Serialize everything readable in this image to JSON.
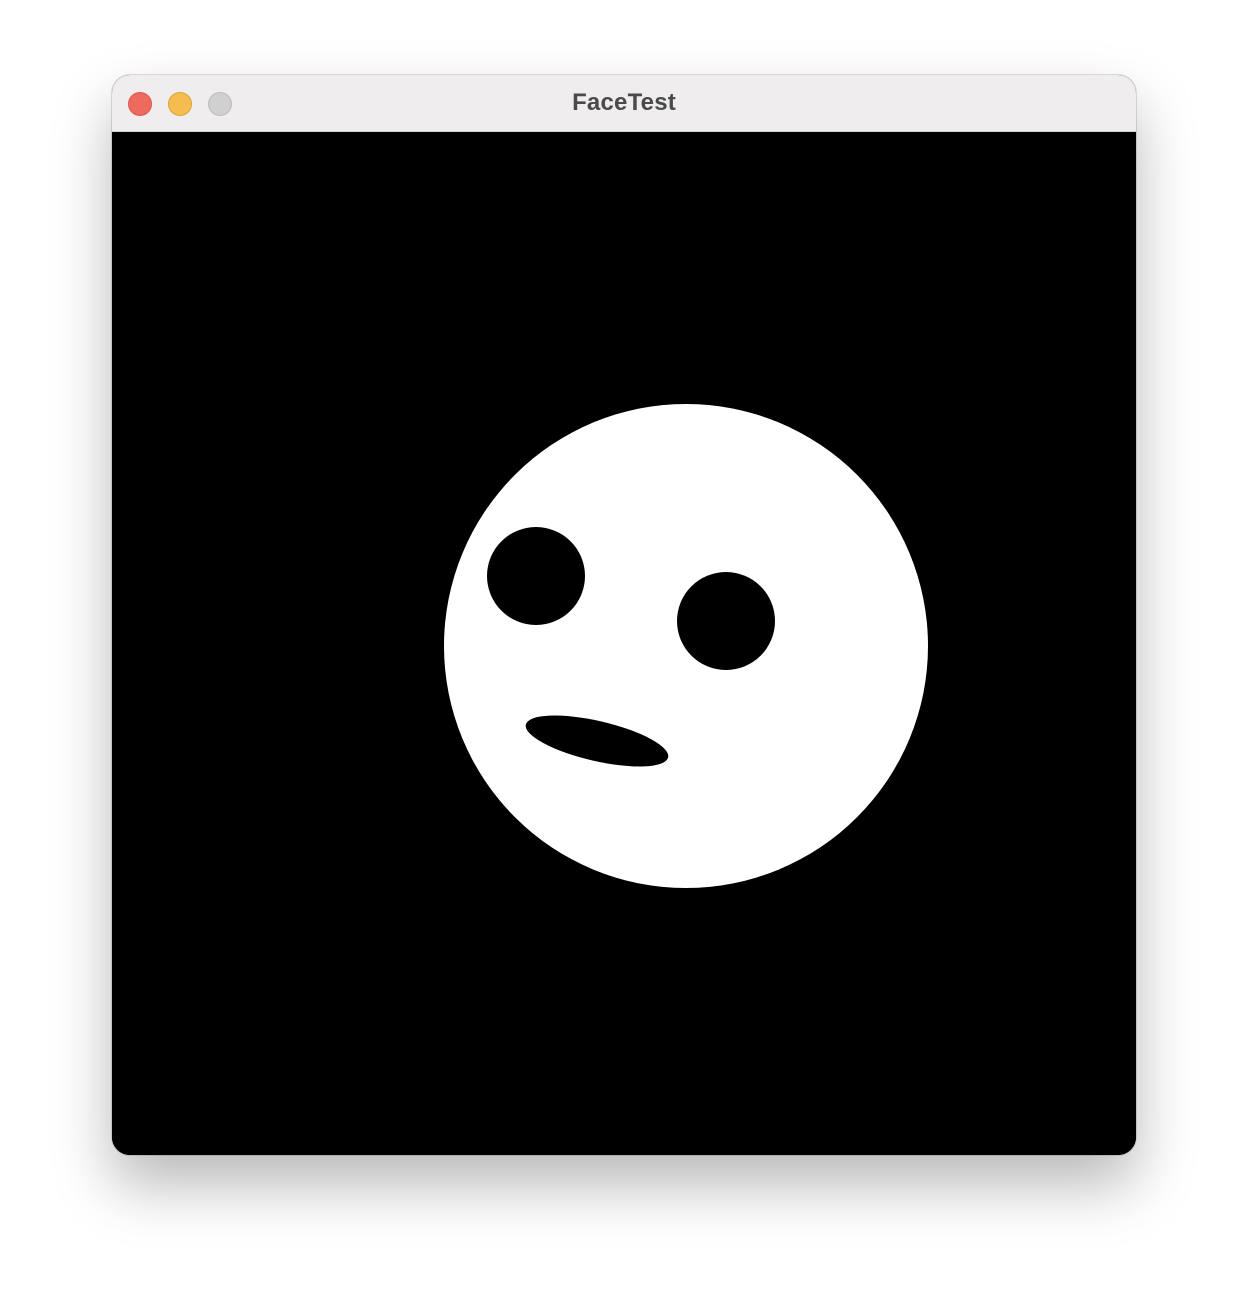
{
  "window": {
    "title": "FaceTest",
    "controls": [
      "close",
      "minimize",
      "zoom"
    ]
  },
  "canvas": {
    "background_color": "#000000",
    "face_color": "#ffffff",
    "feature_color": "#000000"
  }
}
